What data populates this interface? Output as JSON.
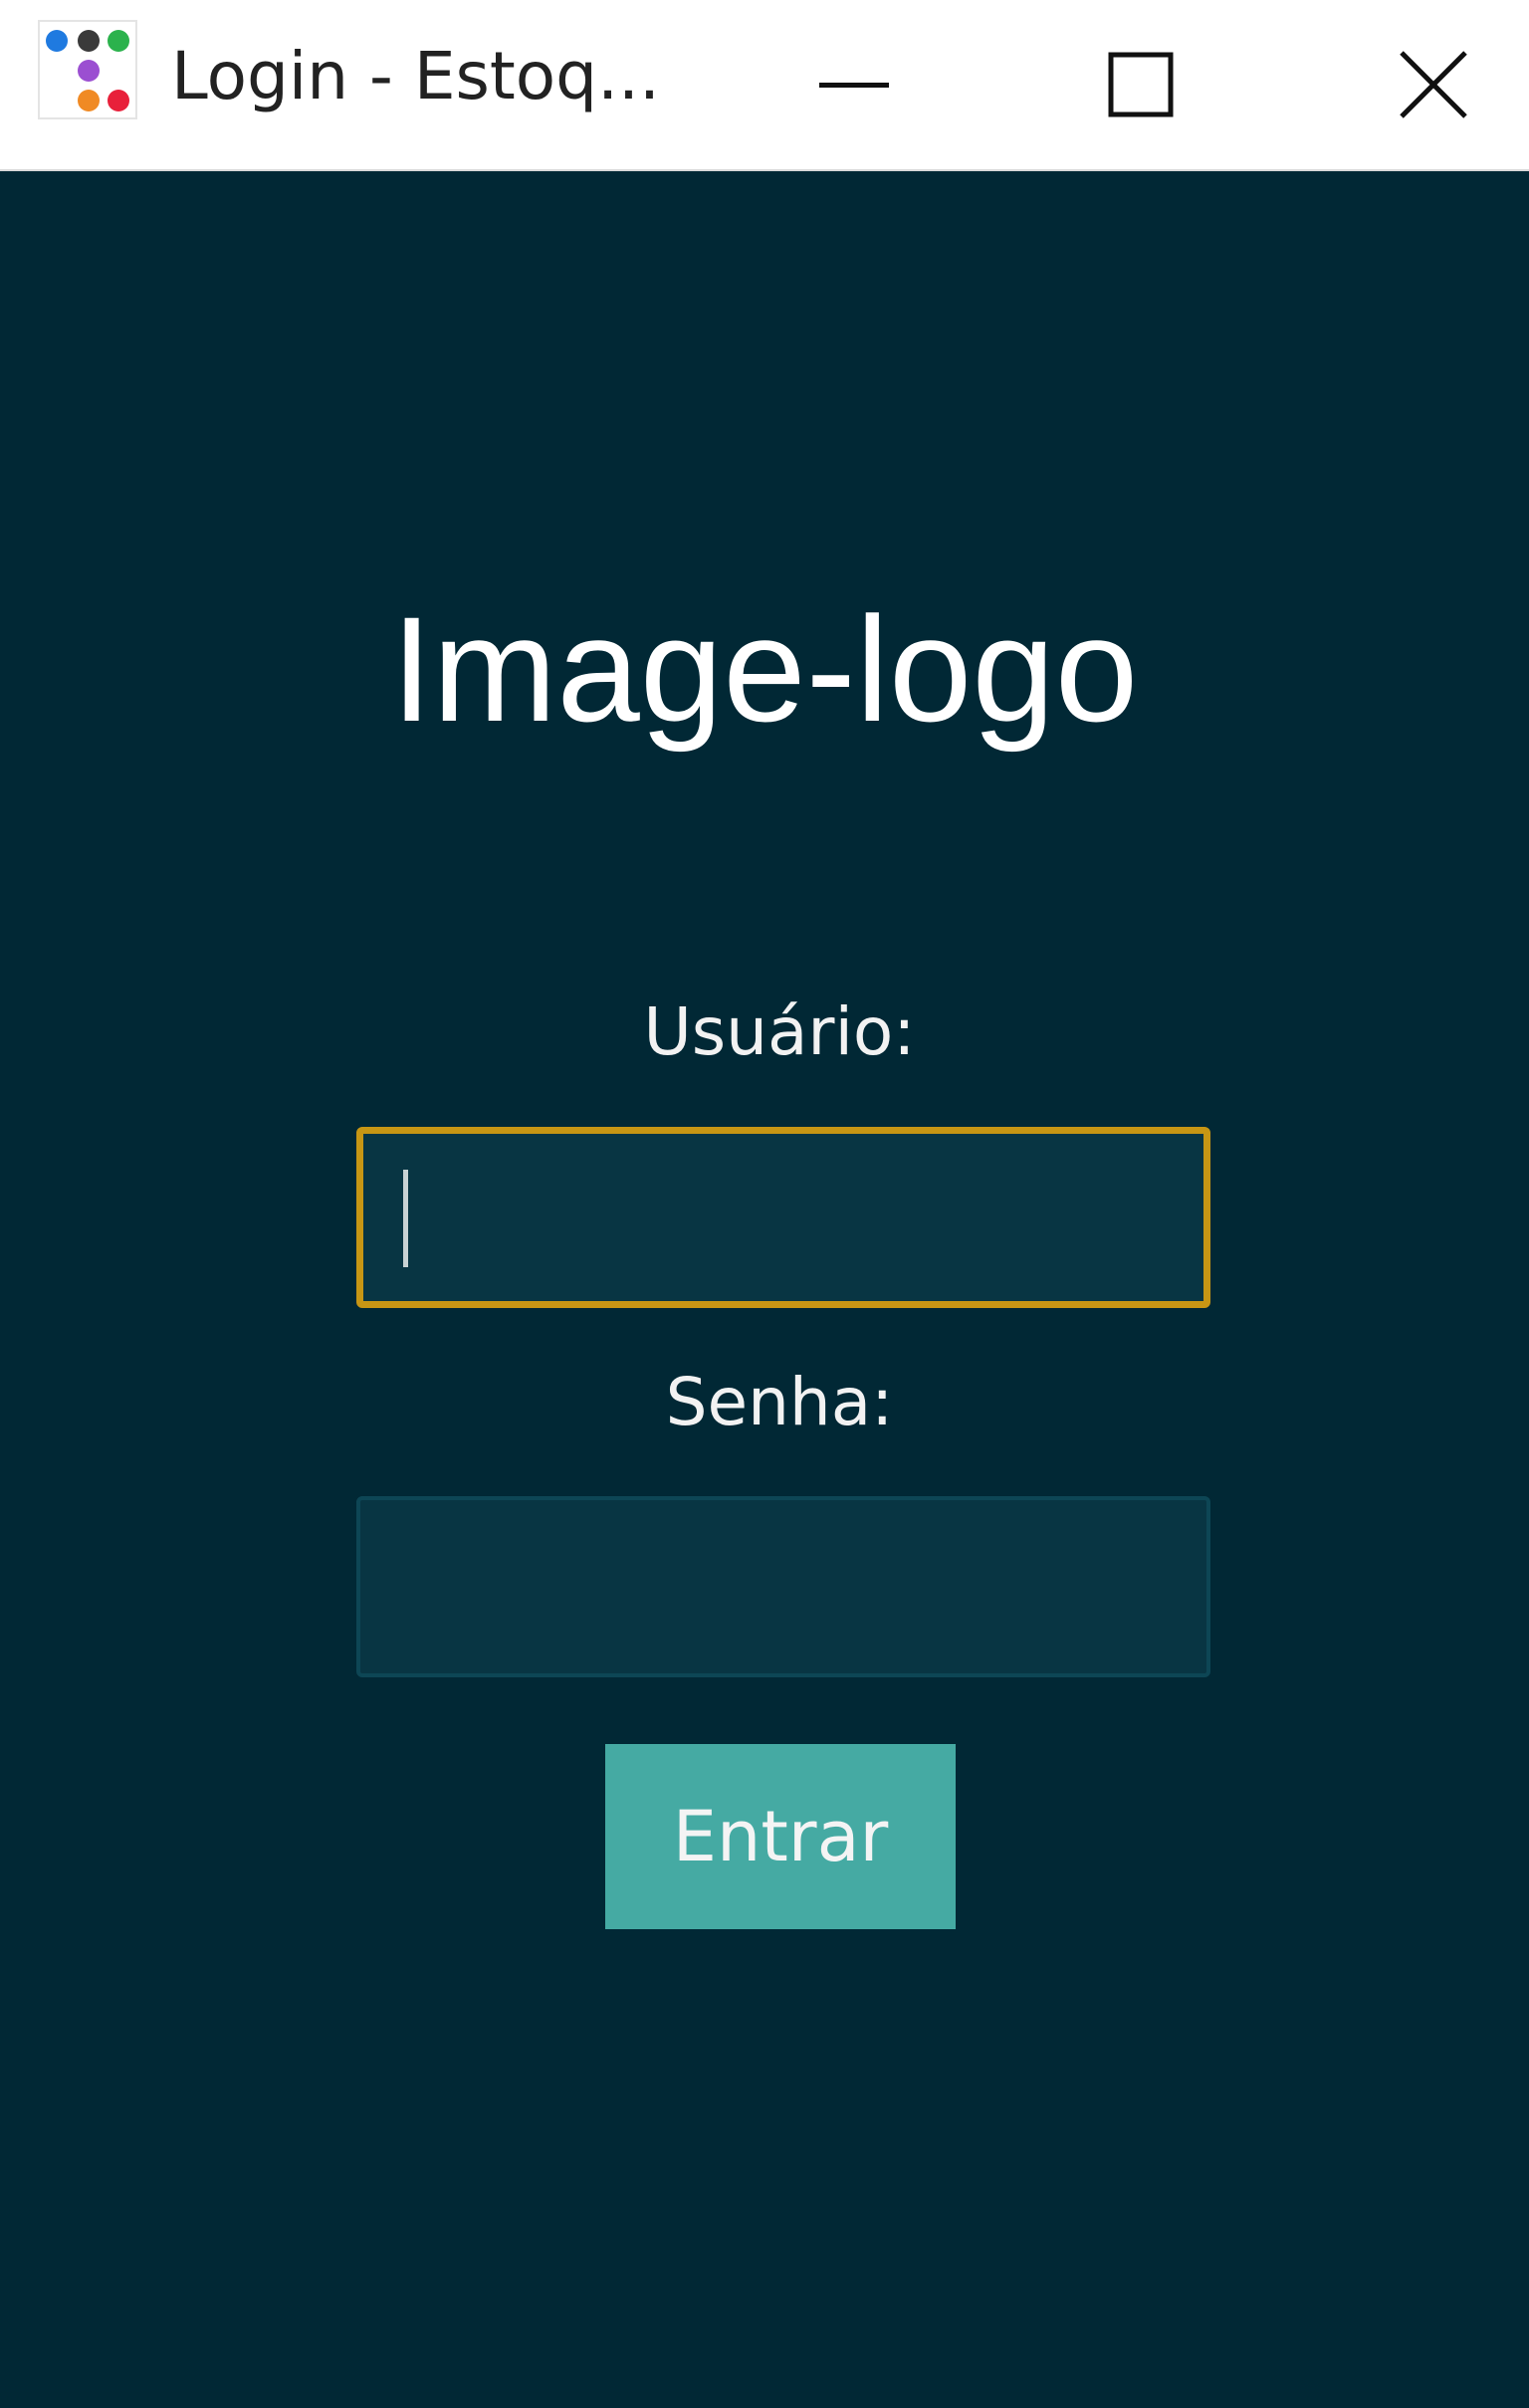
{
  "window": {
    "title": "Login - Estoq...",
    "icon": "app-dots-icon",
    "controls": {
      "minimize": "minimize-icon",
      "maximize": "maximize-icon",
      "close": "close-icon"
    }
  },
  "login": {
    "logo_text": "Image-logo",
    "username_label": "Usuário:",
    "username_value": "",
    "password_label": "Senha:",
    "password_value": "",
    "submit_label": "Entrar"
  },
  "colors": {
    "background": "#012835",
    "input_background": "#083543",
    "focus_border": "#c79614",
    "button": "#45aaa3"
  }
}
